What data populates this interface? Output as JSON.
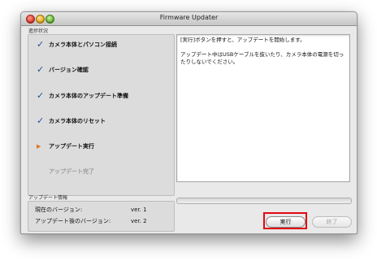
{
  "window": {
    "title": "Firmware Updater"
  },
  "steps_group_label": "進捗状況",
  "steps": [
    {
      "label": "カメラ本体とパソコン接続",
      "state": "done"
    },
    {
      "label": "バージョン確認",
      "state": "done"
    },
    {
      "label": "カメラ本体のアップデート準備",
      "state": "done"
    },
    {
      "label": "カメラ本体のリセット",
      "state": "done"
    },
    {
      "label": "アップデート実行",
      "state": "current"
    },
    {
      "label": "アップデート完了",
      "state": "pending"
    }
  ],
  "message": {
    "line1": "[実行]ボタンを押すと、アップデートを開始します。",
    "line2": "アップデート中はUSBケーブルを抜いたり、カメラ本体の電源を切ったりしないでください。"
  },
  "update_info": {
    "label": "アップデート情報",
    "current_version_label": "現在のバージョン:",
    "current_version_value": "ver. 1",
    "updated_version_label": "アップデート後のバージョン:",
    "updated_version_value": "ver. 2"
  },
  "buttons": {
    "execute": "実行",
    "finish": "終了"
  },
  "colors": {
    "check": "#1f4fa3",
    "current_arrow": "#e2751e",
    "highlight": "#e30613"
  },
  "icons": {
    "done": "check-icon",
    "current": "arrow-right-icon"
  }
}
